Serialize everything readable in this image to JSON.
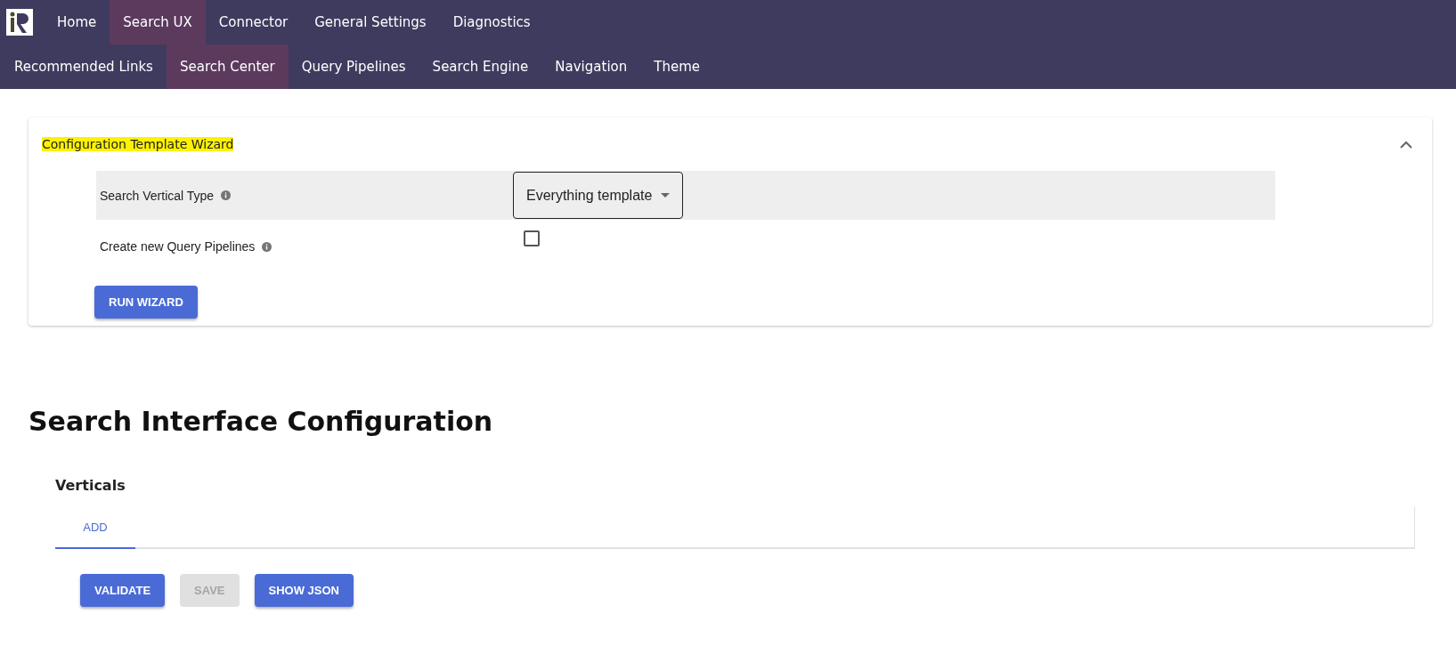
{
  "top_nav": [
    {
      "label": "Home",
      "selected": false
    },
    {
      "label": "Search UX",
      "selected": true
    },
    {
      "label": "Connector",
      "selected": false
    },
    {
      "label": "General Settings",
      "selected": false
    },
    {
      "label": "Diagnostics",
      "selected": false
    }
  ],
  "sub_nav": [
    {
      "label": "Recommended Links",
      "selected": false
    },
    {
      "label": "Search Center",
      "selected": true
    },
    {
      "label": "Query Pipelines",
      "selected": false
    },
    {
      "label": "Search Engine",
      "selected": false
    },
    {
      "label": "Navigation",
      "selected": false
    },
    {
      "label": "Theme",
      "selected": false
    }
  ],
  "wizard": {
    "title": "Configuration Template Wizard",
    "highlighted": true,
    "expanded": true,
    "fields": [
      {
        "kind": "select",
        "label": "Search Vertical Type",
        "value": "Everything template"
      },
      {
        "kind": "checkbox",
        "label": "Create new Query Pipelines",
        "checked": false
      }
    ],
    "button": "RUN WIZARD"
  },
  "heading": "Search Interface Configuration",
  "verticals": {
    "title": "Verticals",
    "tabs": [
      {
        "label": "ADD",
        "selected": true
      }
    ]
  },
  "buttons": [
    {
      "label": "VALIDATE",
      "disabled": false
    },
    {
      "label": "SAVE",
      "disabled": true
    },
    {
      "label": "SHOW JSON",
      "disabled": false
    }
  ]
}
